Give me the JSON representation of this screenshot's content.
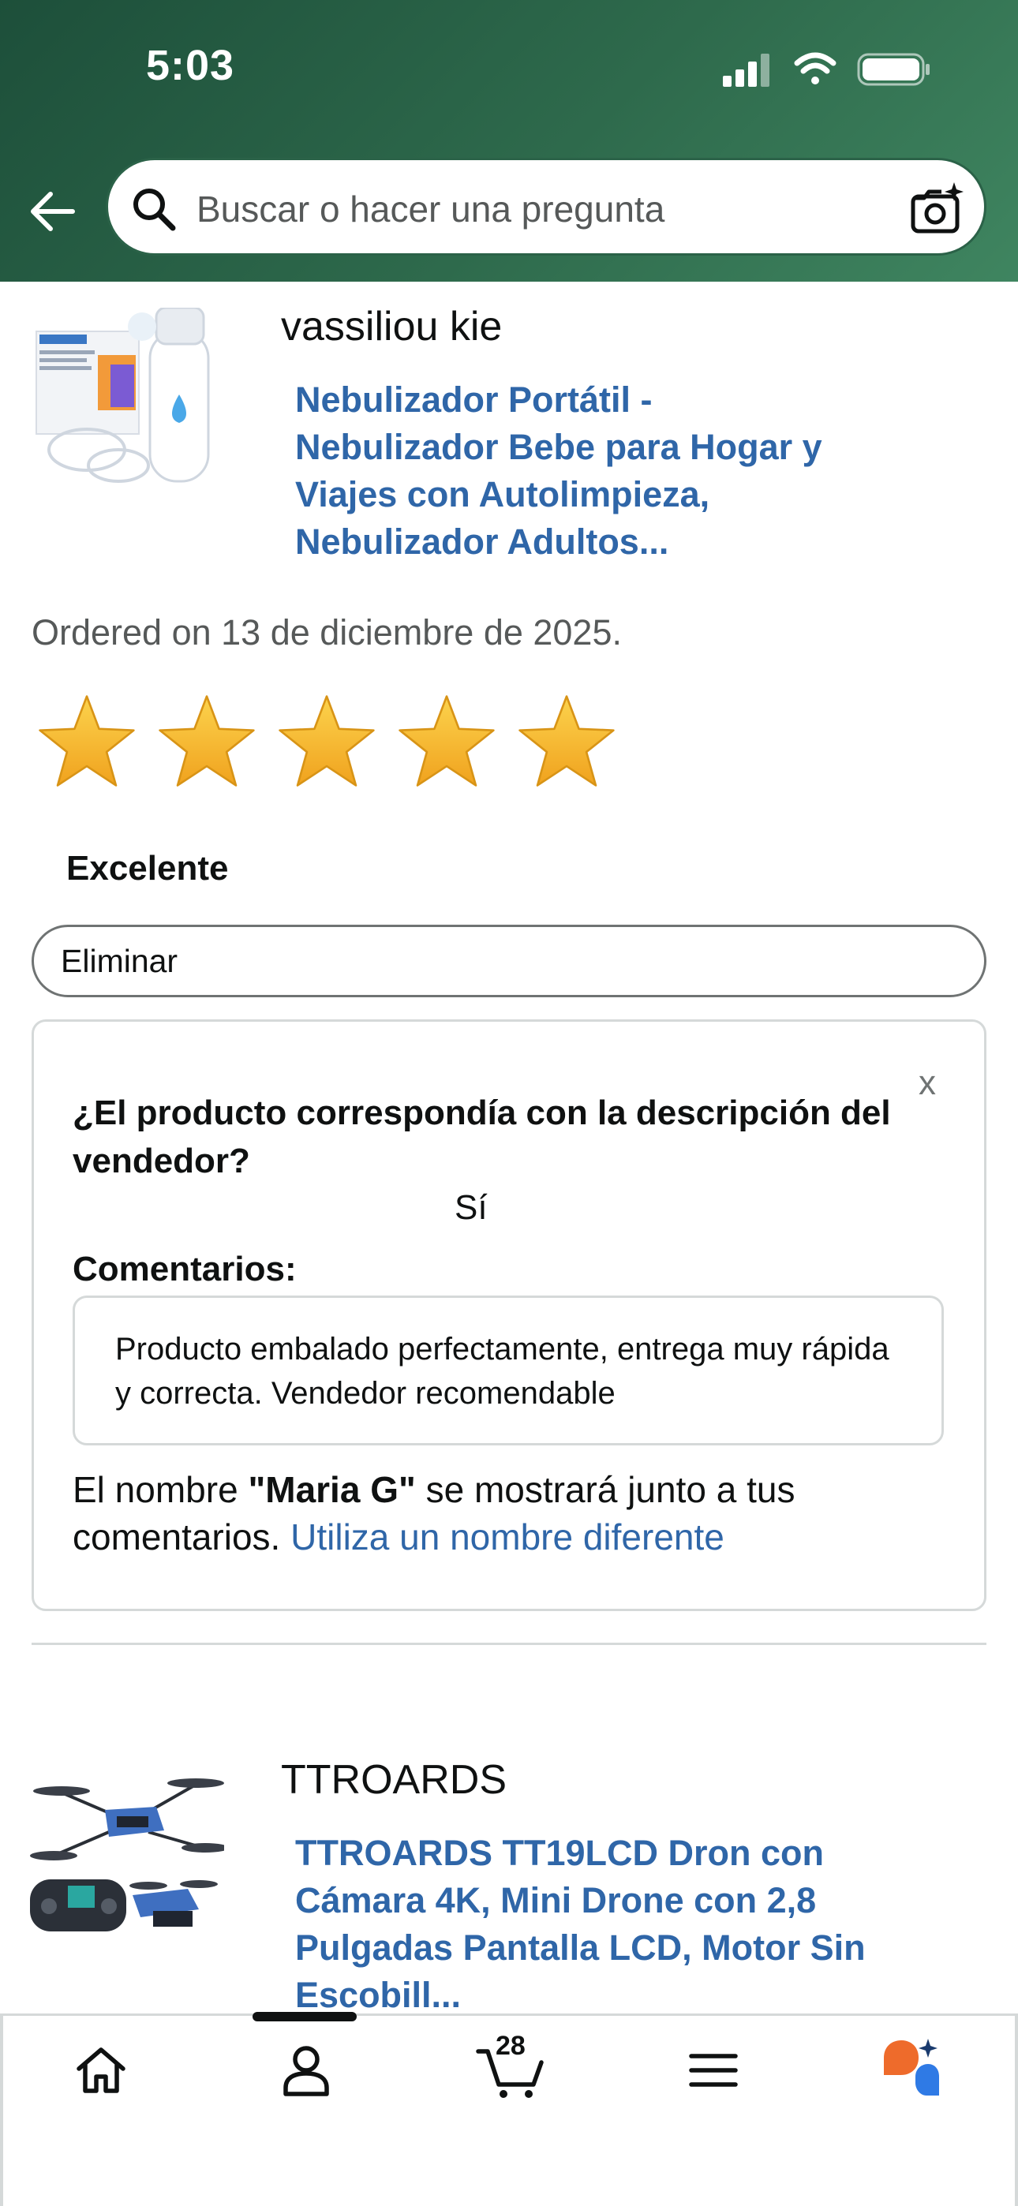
{
  "status_bar": {
    "time": "5:03",
    "icons": [
      "cellular-signal-icon",
      "wifi-icon",
      "battery-icon"
    ]
  },
  "search": {
    "placeholder": "Buscar o hacer una pregunta",
    "icons": [
      "back-arrow-icon",
      "search-icon",
      "camera-search-icon"
    ]
  },
  "review": {
    "seller": "vassiliou kie",
    "product_title_lines": [
      "Nebulizador Portátil -",
      "Nebulizador Bebe para Hogar y",
      "Viajes con Autolimpieza,",
      "Nebulizador Adultos..."
    ],
    "ordered": "Ordered on 13 de diciembre de 2025.",
    "rating": 5,
    "rating_max": 5,
    "rating_label": "Excelente",
    "delete_label": "Eliminar"
  },
  "feedback": {
    "close_label": "x",
    "question": "¿El producto correspondía con la descripción del vendedor?",
    "answer": "Sí",
    "comments_label": "Comentarios:",
    "comment_text": "Producto embalado perfectamente, entrega muy rápida y correcta. Vendedor recomendable",
    "name_prefix": "El nombre ",
    "name": "\"Maria G\"",
    "name_suffix": " se mostrará junto a tus comentarios. ",
    "name_link": "Utiliza un nombre diferente"
  },
  "next_item": {
    "seller": "TTROARDS",
    "product_title_lines": [
      "TTROARDS TT19LCD Dron con",
      "Cámara 4K, Mini Drone con 2,8",
      "Pulgadas Pantalla LCD, Motor Sin",
      "Escobill..."
    ]
  },
  "tab_bar": {
    "cart_count": "28",
    "tabs": [
      "home-icon",
      "account-icon",
      "cart-icon",
      "menu-icon",
      "rufus-ai-icon"
    ]
  },
  "colors": {
    "header_green": "#2e6a4c",
    "link_blue": "#2f66a8",
    "star_gold": "#f7b928",
    "rufus_orange": "#ee6b2b",
    "rufus_blue": "#2f7ae5"
  }
}
